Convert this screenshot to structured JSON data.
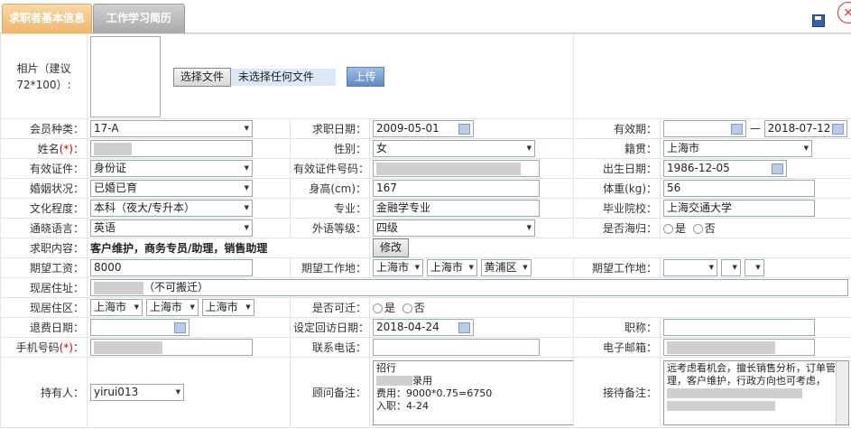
{
  "tabs": {
    "basic": "求职者基本信息",
    "history": "工作学习简历"
  },
  "icons": {
    "save": "save-icon",
    "close": "close-icon"
  },
  "photo": {
    "label": "相片（建议72*100）:",
    "choose_btn": "选择文件",
    "no_file": "未选择任何文件",
    "upload_btn": "上传"
  },
  "labels": {
    "member_type": "会员种类：",
    "apply_date": "求职日期：",
    "valid_period": "有效期：",
    "name": "姓名",
    "gender": "性别：",
    "native": "籍贯：",
    "id_type": "有效证件：",
    "id_no": "有效证件号码：",
    "birth": "出生日期：",
    "marriage": "婚姻状况：",
    "height": "身高(cm)：",
    "weight": "体重(kg)：",
    "education": "文化程度：",
    "major": "专业：",
    "school": "毕业院校：",
    "language": "通晓语言：",
    "foreign_level": "外语等级：",
    "overseas": "是否海归：",
    "content": "求职内容：",
    "salary": "期望工资：",
    "expect_loc1": "期望工作地：",
    "expect_loc2": "期望工作地：",
    "address": "现居住址：",
    "area": "现居住区：",
    "relocate": "是否可迁：",
    "refund_date": "退费日期：",
    "visit_date": "设定回访日期：",
    "title": "职称：",
    "phone": "手机号码",
    "contact_phone": "联系电话：",
    "email": "电子邮箱：",
    "holder": "持有人：",
    "advisor_note": "顾问备注：",
    "reception_note": "接待备注："
  },
  "required_mark": "(*)：",
  "values": {
    "member_type": "17-A",
    "apply_date": "2009-05-01",
    "valid_to": "2018-07-12",
    "valid_sep": "—",
    "gender": "女",
    "native": "上海市",
    "id_type": "身份证",
    "birth": "1986-12-05",
    "marriage": "已婚已育",
    "height": "167",
    "weight": "56",
    "education": "本科（夜大/专升本）",
    "major": "金融学专业",
    "school": "上海交通大学",
    "language": "英语",
    "foreign_level": "四级",
    "yes": "是",
    "no": "否",
    "content": "客户维护，商务专员/助理，销售助理",
    "edit_btn": "修改",
    "salary": "8000",
    "loc1a": "上海市",
    "loc1b": "上海市",
    "loc1c": "黄浦区",
    "address_suffix": "（不可搬迁）",
    "area_a": "上海市",
    "area_b": "上海市",
    "area_c": "上海市",
    "visit_date": "2018-04-24",
    "holder": "yirui013",
    "advisor_l1": "招行",
    "advisor_l2": "录用",
    "advisor_l3": "费用：9000*0.75=6750",
    "advisor_l4": "入职：4-24",
    "reception": "远考虑看机会，擅长销售分析，订单管理，客户维护，行政方向也可考虑，"
  }
}
